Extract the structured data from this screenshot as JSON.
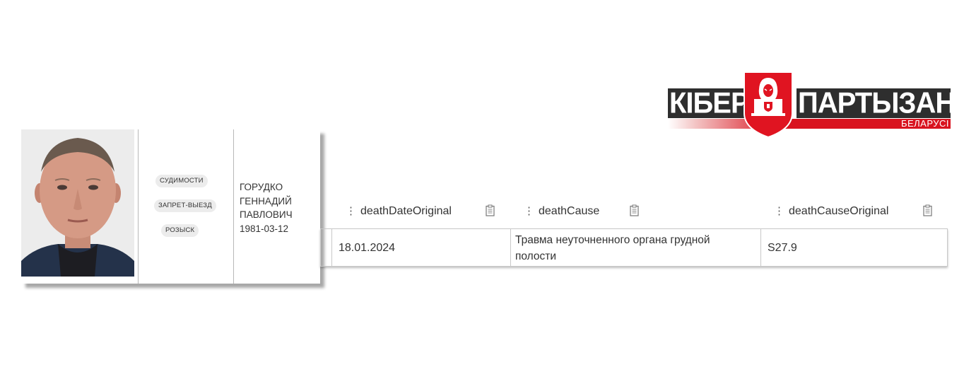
{
  "logo": {
    "left_word": "КІБЕР",
    "right_word": "ПАРТЫЗАНЫ",
    "sub": "БЕЛАРУСІ"
  },
  "profile": {
    "badges": [
      "СУДИМОСТИ",
      "ЗАПРЕТ-ВЫЕЗД",
      "РОЗЫСК"
    ],
    "last_name": "ГОРУДКО",
    "first_name": "ГЕННАДИЙ",
    "patronymic": "ПАВЛОВИЧ",
    "birth_date": "1981-03-12"
  },
  "table": {
    "columns": [
      "deathDateOriginal",
      "deathCause",
      "deathCauseOriginal"
    ],
    "row": {
      "deathDateOriginal": "18.01.2024",
      "deathCause_line1": "Травма неуточненного органа грудной",
      "deathCause_line2": "полости",
      "deathCauseOriginal": "S27.9"
    }
  },
  "colors": {
    "brand_red": "#d9131f",
    "brand_dark": "#2e2e2e",
    "border": "#c8c8c8"
  },
  "icons": [
    "drag-handle-icon",
    "clipboard-icon",
    "hacker-shield-icon"
  ]
}
